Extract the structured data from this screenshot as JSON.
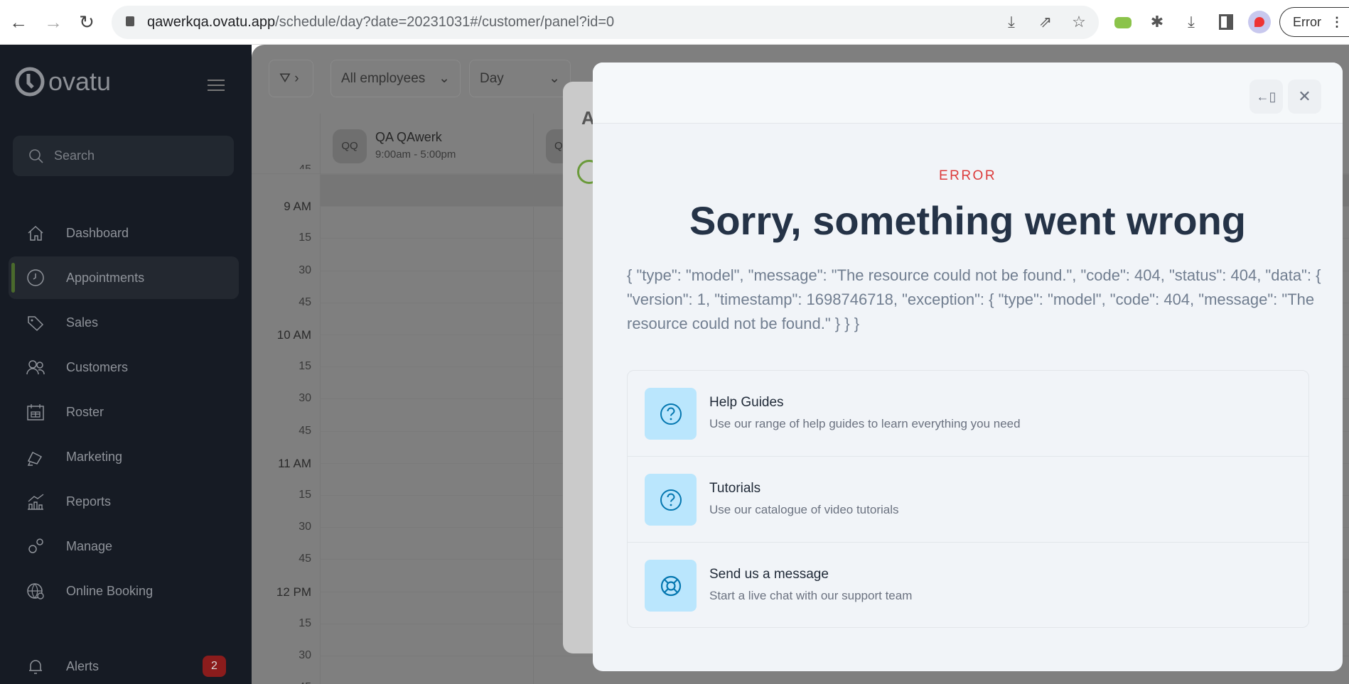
{
  "browser": {
    "url_host": "qawerkqa.ovatu.app",
    "url_path": "/schedule/day?date=20231031#/customer/panel?id=0",
    "profile_button": "Error"
  },
  "sidebar": {
    "logo": "ovatu",
    "search_placeholder": "Search",
    "items": [
      {
        "label": "Dashboard",
        "icon": "home-icon"
      },
      {
        "label": "Appointments",
        "icon": "clock-icon",
        "active": true
      },
      {
        "label": "Sales",
        "icon": "tag-icon"
      },
      {
        "label": "Customers",
        "icon": "users-icon"
      },
      {
        "label": "Roster",
        "icon": "calendar-icon"
      },
      {
        "label": "Marketing",
        "icon": "megaphone-icon"
      },
      {
        "label": "Reports",
        "icon": "chart-icon"
      },
      {
        "label": "Manage",
        "icon": "gears-icon"
      },
      {
        "label": "Online Booking",
        "icon": "globe-gear-icon"
      }
    ],
    "alerts": {
      "label": "Alerts",
      "count": "2"
    }
  },
  "schedule": {
    "employee_filter": "All employees",
    "view": "Day",
    "employee": {
      "initials": "QQ",
      "name": "QA QAwerk",
      "hours": "9:00am - 5:00pm"
    },
    "second_employee_initial": "Q",
    "times": [
      "45",
      "9 AM",
      "15",
      "30",
      "45",
      "10 AM",
      "15",
      "30",
      "45",
      "11 AM",
      "15",
      "30",
      "45",
      "12 PM",
      "15",
      "30",
      "45"
    ],
    "behind_panel_title": "A"
  },
  "error_modal": {
    "label": "ERROR",
    "title": "Sorry, something went wrong",
    "message": "{ \"type\": \"model\", \"message\": \"The resource could not be found.\", \"code\": 404, \"status\": 404, \"data\": { \"version\": 1, \"timestamp\": 1698746718, \"exception\": { \"type\": \"model\", \"code\": 404, \"message\": \"The resource could not be found.\" } } }",
    "cards": [
      {
        "title": "Help Guides",
        "description": "Use our range of help guides to learn everything you need",
        "icon": "question-circle-icon"
      },
      {
        "title": "Tutorials",
        "description": "Use our catalogue of video tutorials",
        "icon": "question-circle-icon"
      },
      {
        "title": "Send us a message",
        "description": "Start a live chat with our support team",
        "icon": "lifebuoy-icon"
      }
    ],
    "colors": {
      "accent": "#dc3b3b",
      "icon_bg": "#bae6fd",
      "icon": "#0477b0"
    }
  }
}
